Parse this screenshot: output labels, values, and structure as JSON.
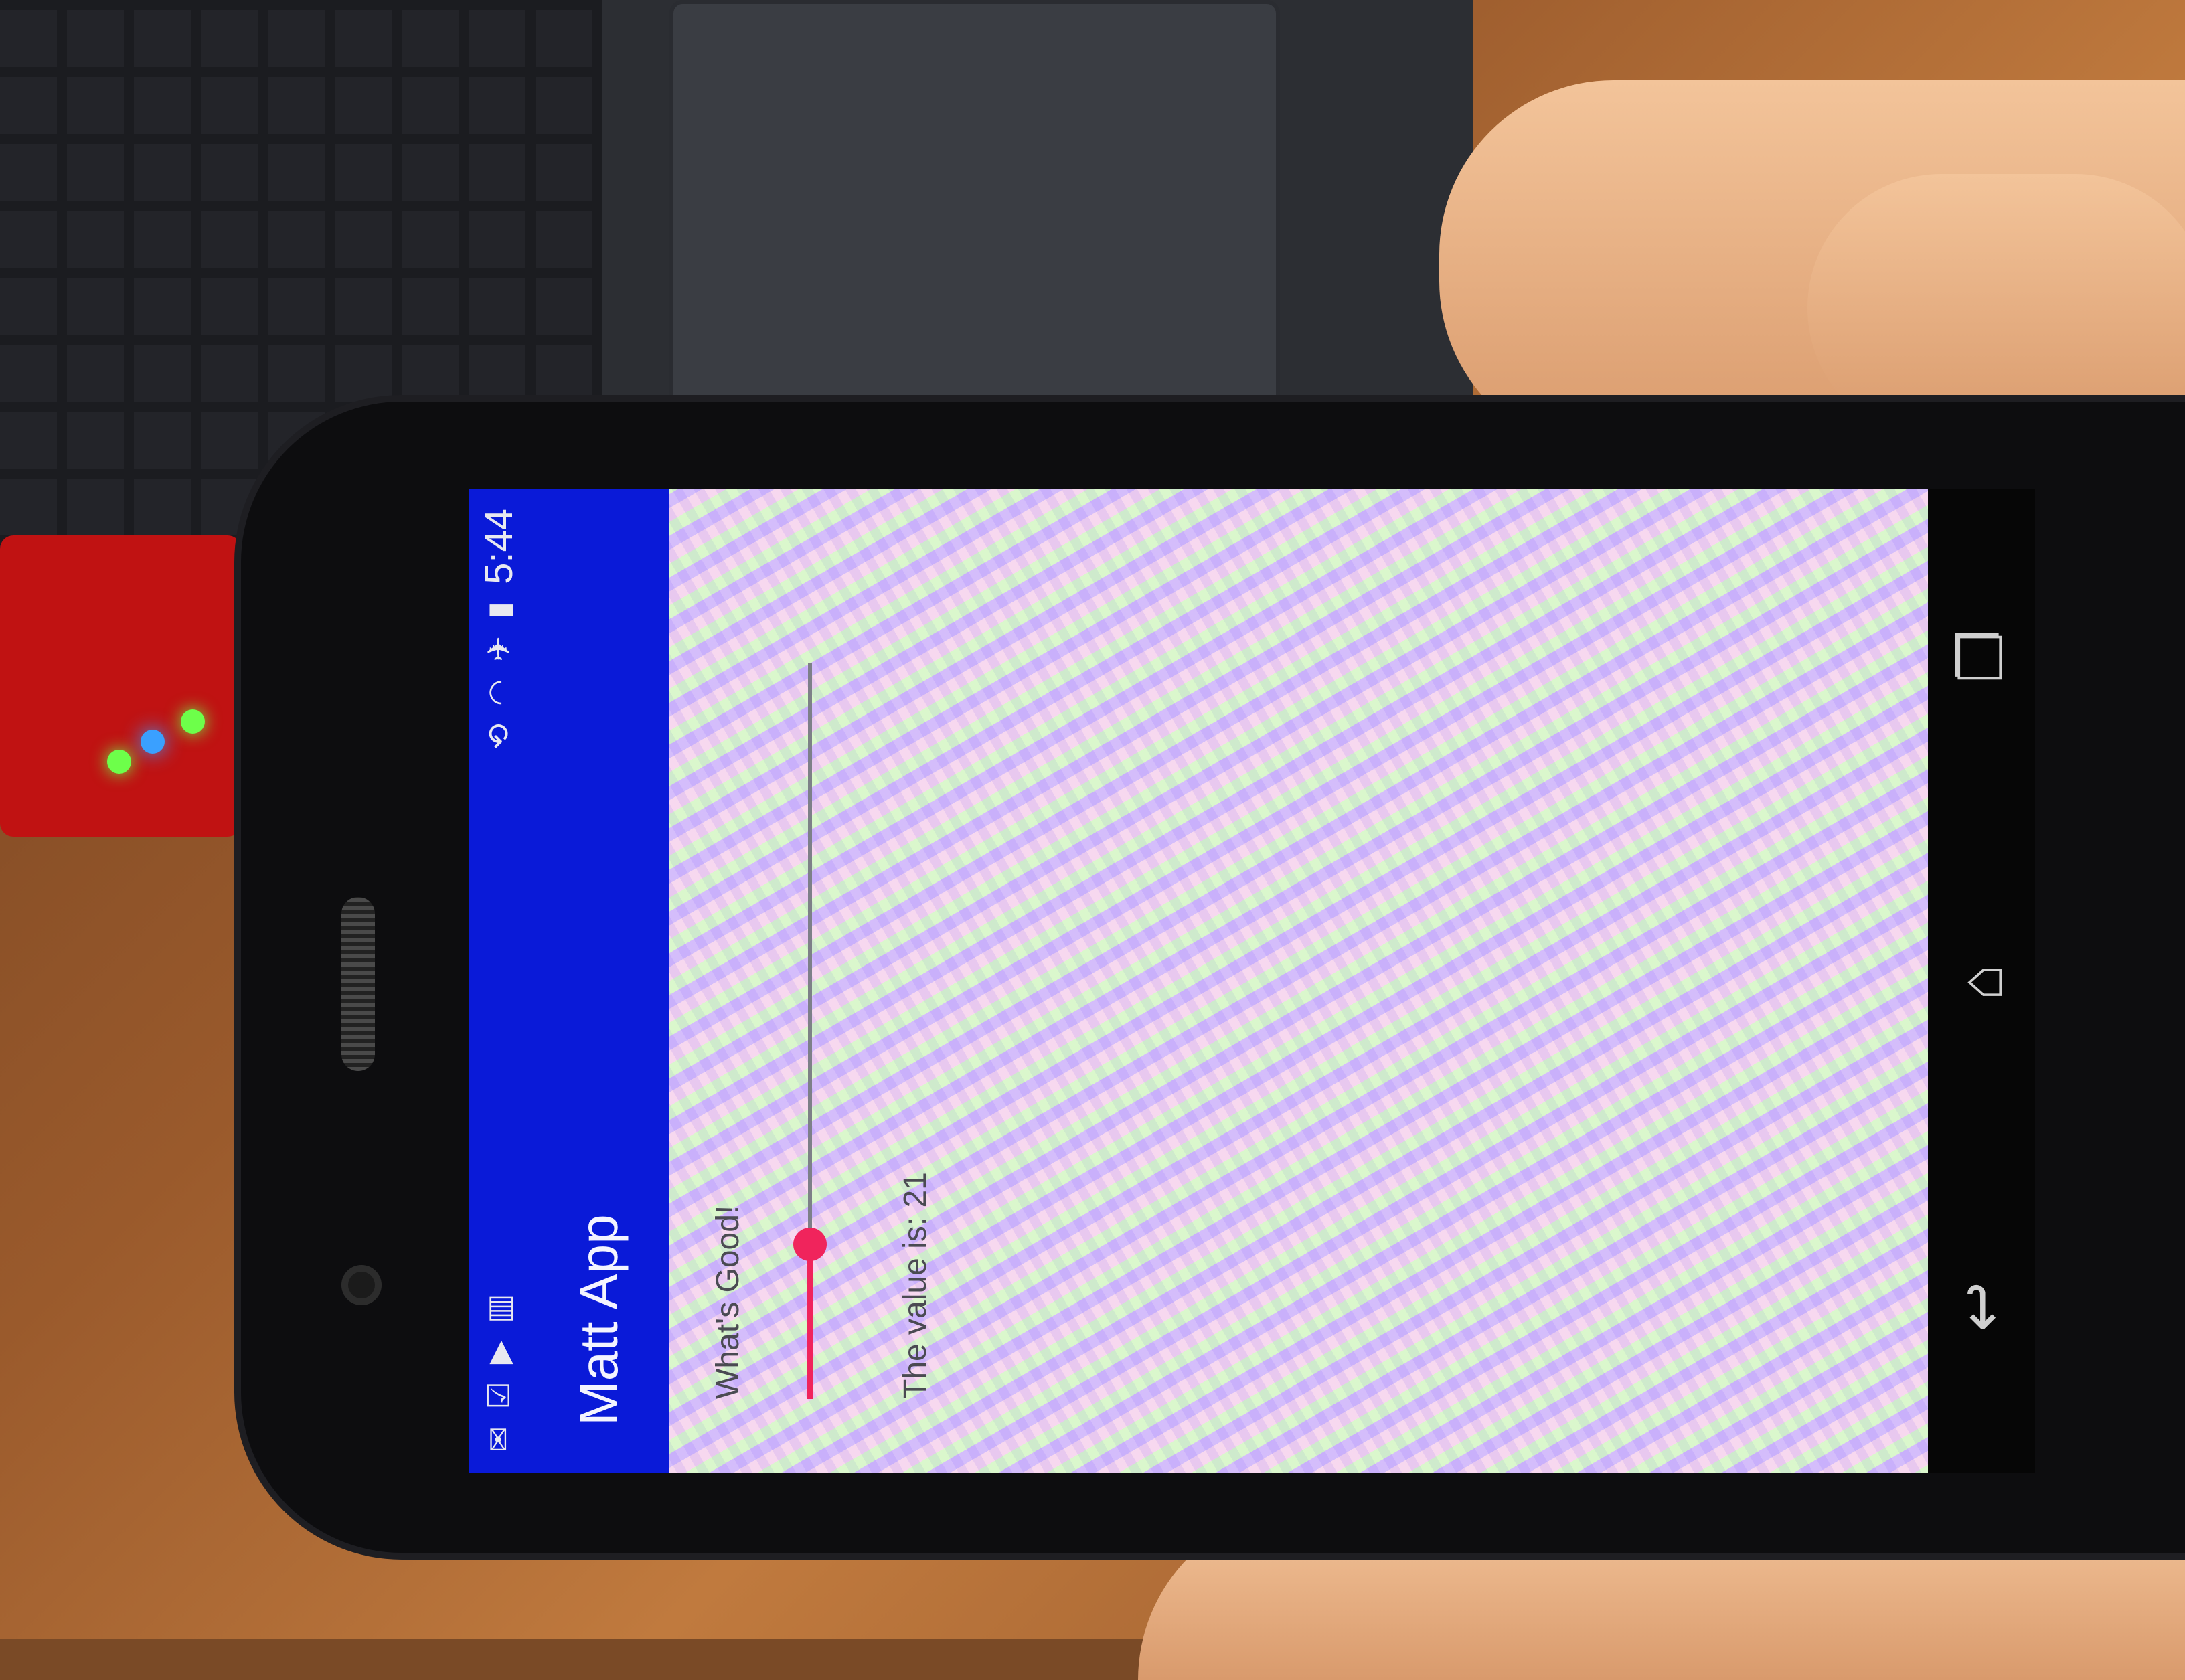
{
  "status_bar": {
    "clock": "5:44",
    "left_icons": [
      "gmail-icon",
      "checkbox-icon",
      "play-store-icon",
      "barcode-icon"
    ],
    "right_icons": [
      "rotation-icon",
      "wifi-icon",
      "airplane-icon",
      "battery-icon"
    ]
  },
  "app_bar": {
    "title": "Matt App"
  },
  "content": {
    "greeting": "What's Good!",
    "slider": {
      "value_fraction": 0.21
    },
    "value_text": "The value is: 21"
  },
  "nav_bar": {
    "icons": [
      "back-icon",
      "home-icon",
      "recents-icon"
    ]
  },
  "colors": {
    "app_bar": "#0a1ad8",
    "accent": "#f0245c",
    "text": "#4a4a52"
  }
}
